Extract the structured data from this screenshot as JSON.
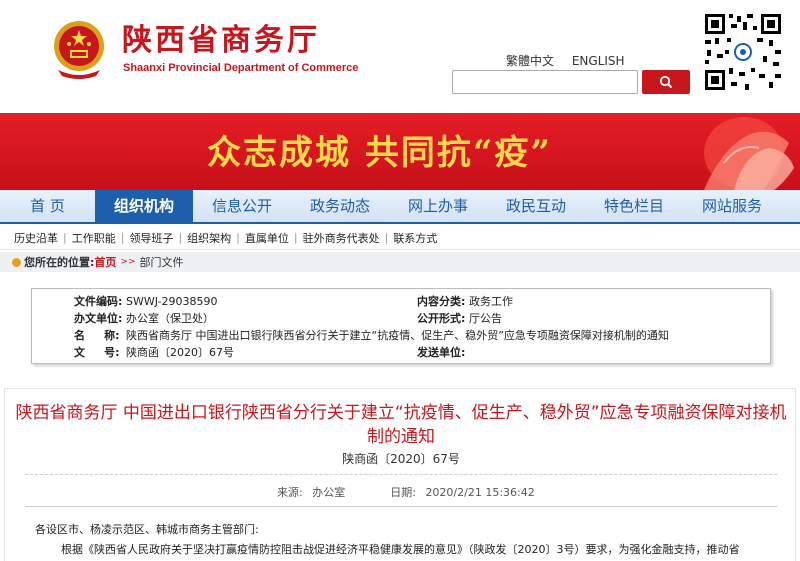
{
  "header": {
    "title_cn": "陕西省商务厅",
    "title_en": "Shaanxi Provincial Department of Commerce",
    "lang_links": [
      "繁體中文",
      "ENGLISH"
    ],
    "search": {
      "placeholder": "",
      "value": ""
    }
  },
  "banner": {
    "slogan": "众志成城   共同抗“疫”"
  },
  "main_nav": {
    "items": [
      "首  页",
      "组织机构",
      "信息公开",
      "政务动态",
      "网上办事",
      "政民互动",
      "特色栏目",
      "网站服务"
    ],
    "active_index": 1
  },
  "sub_nav": {
    "items": [
      "历史沿革",
      "工作职能",
      "领导班子",
      "组织架构",
      "直属单位",
      "驻外商务代表处",
      "联系方式"
    ]
  },
  "breadcrumb": {
    "label": "您所在的位置:",
    "home": "首页",
    "current": "部门文件"
  },
  "meta": {
    "doc_code_label": "文件编码:",
    "doc_code": "SWWJ-29038590",
    "category_label": "内容分类:",
    "category": "政务工作",
    "office_label": "办文单位:",
    "office": "办公室（保卫处）",
    "public_label": "公开形式:",
    "public": "厅公告",
    "name_label": "名     称:",
    "name": "陕西省商务厅 中国进出口银行陕西省分行关于建立“抗疫情、促生产、稳外贸”应急专项融资保障对接机制的通知",
    "docno_label": "文     号:",
    "docno": "陕商函〔2020〕67号",
    "sender_label": "发送单位:",
    "sender": ""
  },
  "article": {
    "title": "陕西省商务厅  中国进出口银行陕西省分行关于建立“抗疫情、促生产、稳外贸”应急专项融资保障对接机制的通知",
    "docno": "陕商函〔2020〕67号",
    "source_label": "来源:",
    "source": "办公室",
    "date_label": "日期:",
    "date": "2020/2/21 15:36:42",
    "addressee": "各设区市、杨凌示范区、韩城市商务主管部门:",
    "para1": "根据《陕西省人民政府关于坚决打赢疫情防控阻击战促进经济平稳健康发展的意见》（陕政发〔2020〕3号）要求，为强化金融支持，推动省"
  },
  "colors": {
    "brand_red": "#c8161d",
    "nav_blue": "#1d5faa",
    "slogan_yellow": "#ffd94a"
  },
  "icons": [
    "national-emblem-icon",
    "search-icon",
    "qr-code-icon",
    "breadcrumb-home-icon"
  ]
}
